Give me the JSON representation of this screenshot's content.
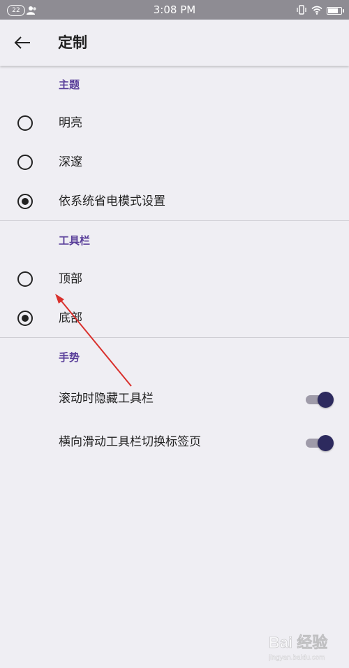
{
  "status_bar": {
    "badge": "22",
    "time": "3:08 PM"
  },
  "app_bar": {
    "title": "定制"
  },
  "sections": [
    {
      "header": "主题",
      "options": [
        {
          "label": "明亮",
          "checked": false
        },
        {
          "label": "深邃",
          "checked": false
        },
        {
          "label": "依系统省电模式设置",
          "checked": true
        }
      ]
    },
    {
      "header": "工具栏",
      "options": [
        {
          "label": "顶部",
          "checked": false
        },
        {
          "label": "底部",
          "checked": true
        }
      ]
    },
    {
      "header": "手势",
      "toggles": [
        {
          "label": "滚动时隐藏工具栏",
          "on": true
        },
        {
          "label": "横向滑动工具栏切换标签页",
          "on": true
        }
      ]
    }
  ],
  "watermark": {
    "text": "Bai 经验",
    "url": "jingyan.baidu.com"
  },
  "colors": {
    "background": "#efeef3",
    "accent": "#5a3f9a",
    "toggle_thumb": "#2d2a5e",
    "annotation": "#d9302c"
  }
}
